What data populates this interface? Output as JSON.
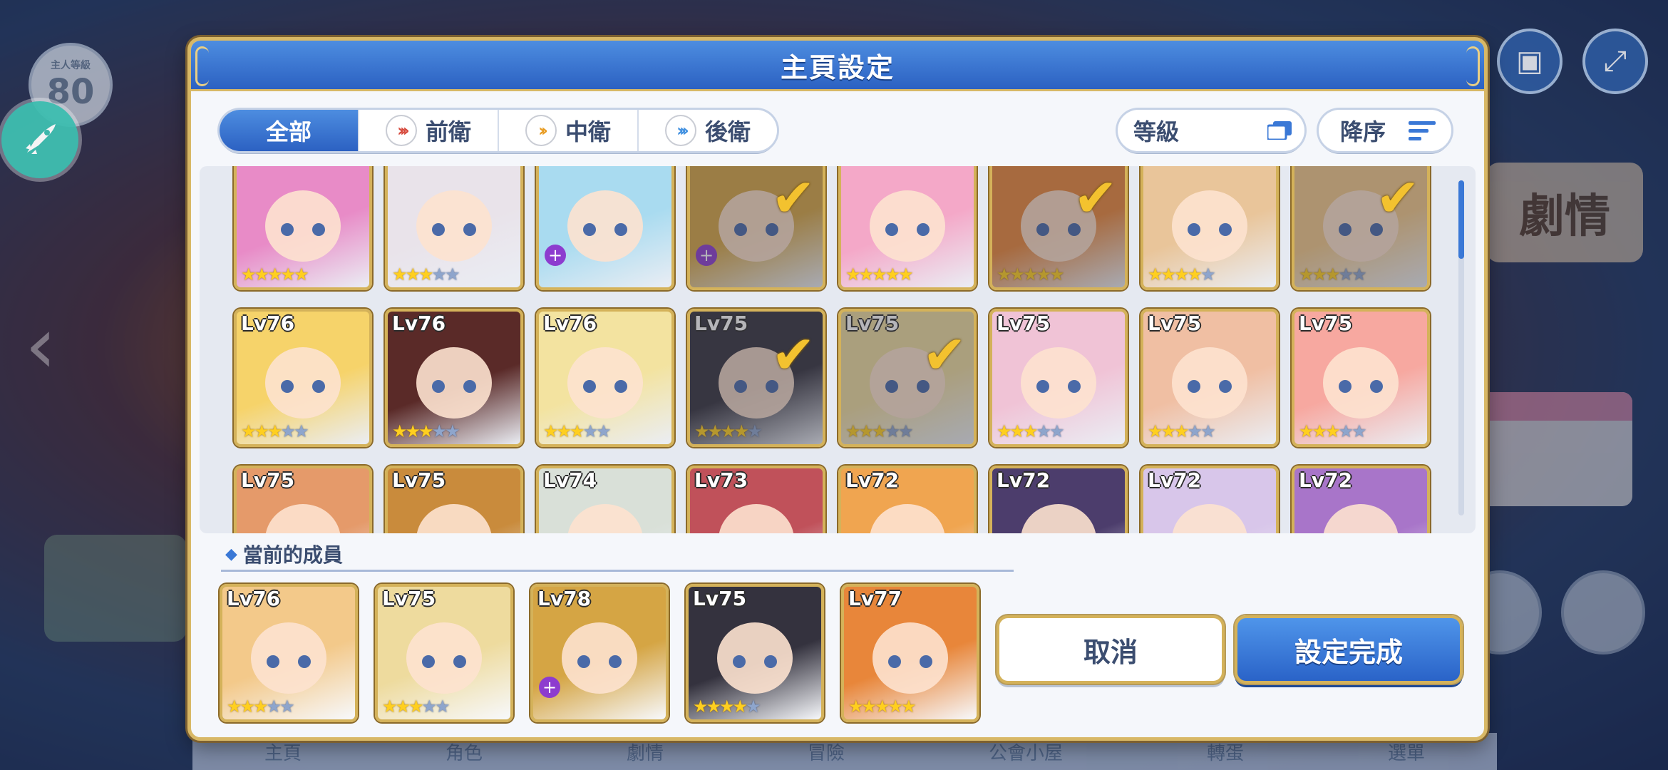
{
  "background": {
    "level": "80",
    "level_label": "主人等級",
    "story_label": "劇情"
  },
  "dialog": {
    "title": "主頁設定",
    "tabs": [
      {
        "label": "全部",
        "active": true
      },
      {
        "label": "前衛",
        "icon": "front-role-icon"
      },
      {
        "label": "中衛",
        "icon": "middle-role-icon"
      },
      {
        "label": "後衛",
        "icon": "back-role-icon"
      }
    ],
    "sort": {
      "level_label": "等級",
      "order_label": "降序"
    },
    "characters": [
      {
        "lv": "",
        "stars": 5,
        "color": "#e88bc7"
      },
      {
        "lv": "",
        "stars": 3,
        "color": "#e9e3ea"
      },
      {
        "lv": "",
        "stars": 0,
        "color": "#a9dbf0",
        "badge": true
      },
      {
        "lv": "",
        "stars": 0,
        "color": "#d5a544",
        "badge": true,
        "selected": true
      },
      {
        "lv": "",
        "stars": 5,
        "color": "#f4a8c8"
      },
      {
        "lv": "",
        "stars": 5,
        "color": "#e8863a",
        "selected": true
      },
      {
        "lv": "",
        "stars": 4,
        "color": "#e9c59a"
      },
      {
        "lv": "",
        "stars": 3,
        "color": "#f2c98a",
        "selected": true
      },
      {
        "lv": "Lv76",
        "stars": 3,
        "color": "#f6d36a"
      },
      {
        "lv": "Lv76",
        "stars": 3,
        "color": "#5a2a28"
      },
      {
        "lv": "Lv76",
        "stars": 3,
        "color": "#f3e3a0"
      },
      {
        "lv": "Lv75",
        "stars": 4,
        "color": "#34323e",
        "selected": true
      },
      {
        "lv": "Lv75",
        "stars": 3,
        "color": "#eedb9e",
        "selected": true
      },
      {
        "lv": "Lv75",
        "stars": 3,
        "color": "#f0c3d6"
      },
      {
        "lv": "Lv75",
        "stars": 3,
        "color": "#f0bfa3"
      },
      {
        "lv": "Lv75",
        "stars": 3,
        "color": "#f7a8a0"
      },
      {
        "lv": "Lv75",
        "stars": 0,
        "color": "#e59a6a"
      },
      {
        "lv": "Lv75",
        "stars": 0,
        "color": "#c98b3c"
      },
      {
        "lv": "Lv74",
        "stars": 0,
        "color": "#d9e0d8"
      },
      {
        "lv": "Lv73",
        "stars": 0,
        "color": "#c0515a"
      },
      {
        "lv": "Lv72",
        "stars": 0,
        "color": "#f0a550"
      },
      {
        "lv": "Lv72",
        "stars": 0,
        "color": "#4c3d6c"
      },
      {
        "lv": "Lv72",
        "stars": 0,
        "color": "#d8c6ea"
      },
      {
        "lv": "Lv72",
        "stars": 0,
        "color": "#a875c9"
      }
    ],
    "members_title": "當前的成員",
    "members": [
      {
        "lv": "Lv76",
        "stars": 3,
        "color": "#f3c98a"
      },
      {
        "lv": "Lv75",
        "stars": 3,
        "color": "#eedb9e"
      },
      {
        "lv": "Lv78",
        "stars": 0,
        "color": "#d5a544",
        "badge": true
      },
      {
        "lv": "Lv75",
        "stars": 4,
        "color": "#34323e"
      },
      {
        "lv": "Lv77",
        "stars": 5,
        "color": "#e8863a"
      }
    ],
    "cancel_label": "取消",
    "confirm_label": "設定完成"
  },
  "bottom_nav": [
    "主頁",
    "角色",
    "劇情",
    "冒險",
    "公會小屋",
    "轉蛋",
    "選單"
  ]
}
